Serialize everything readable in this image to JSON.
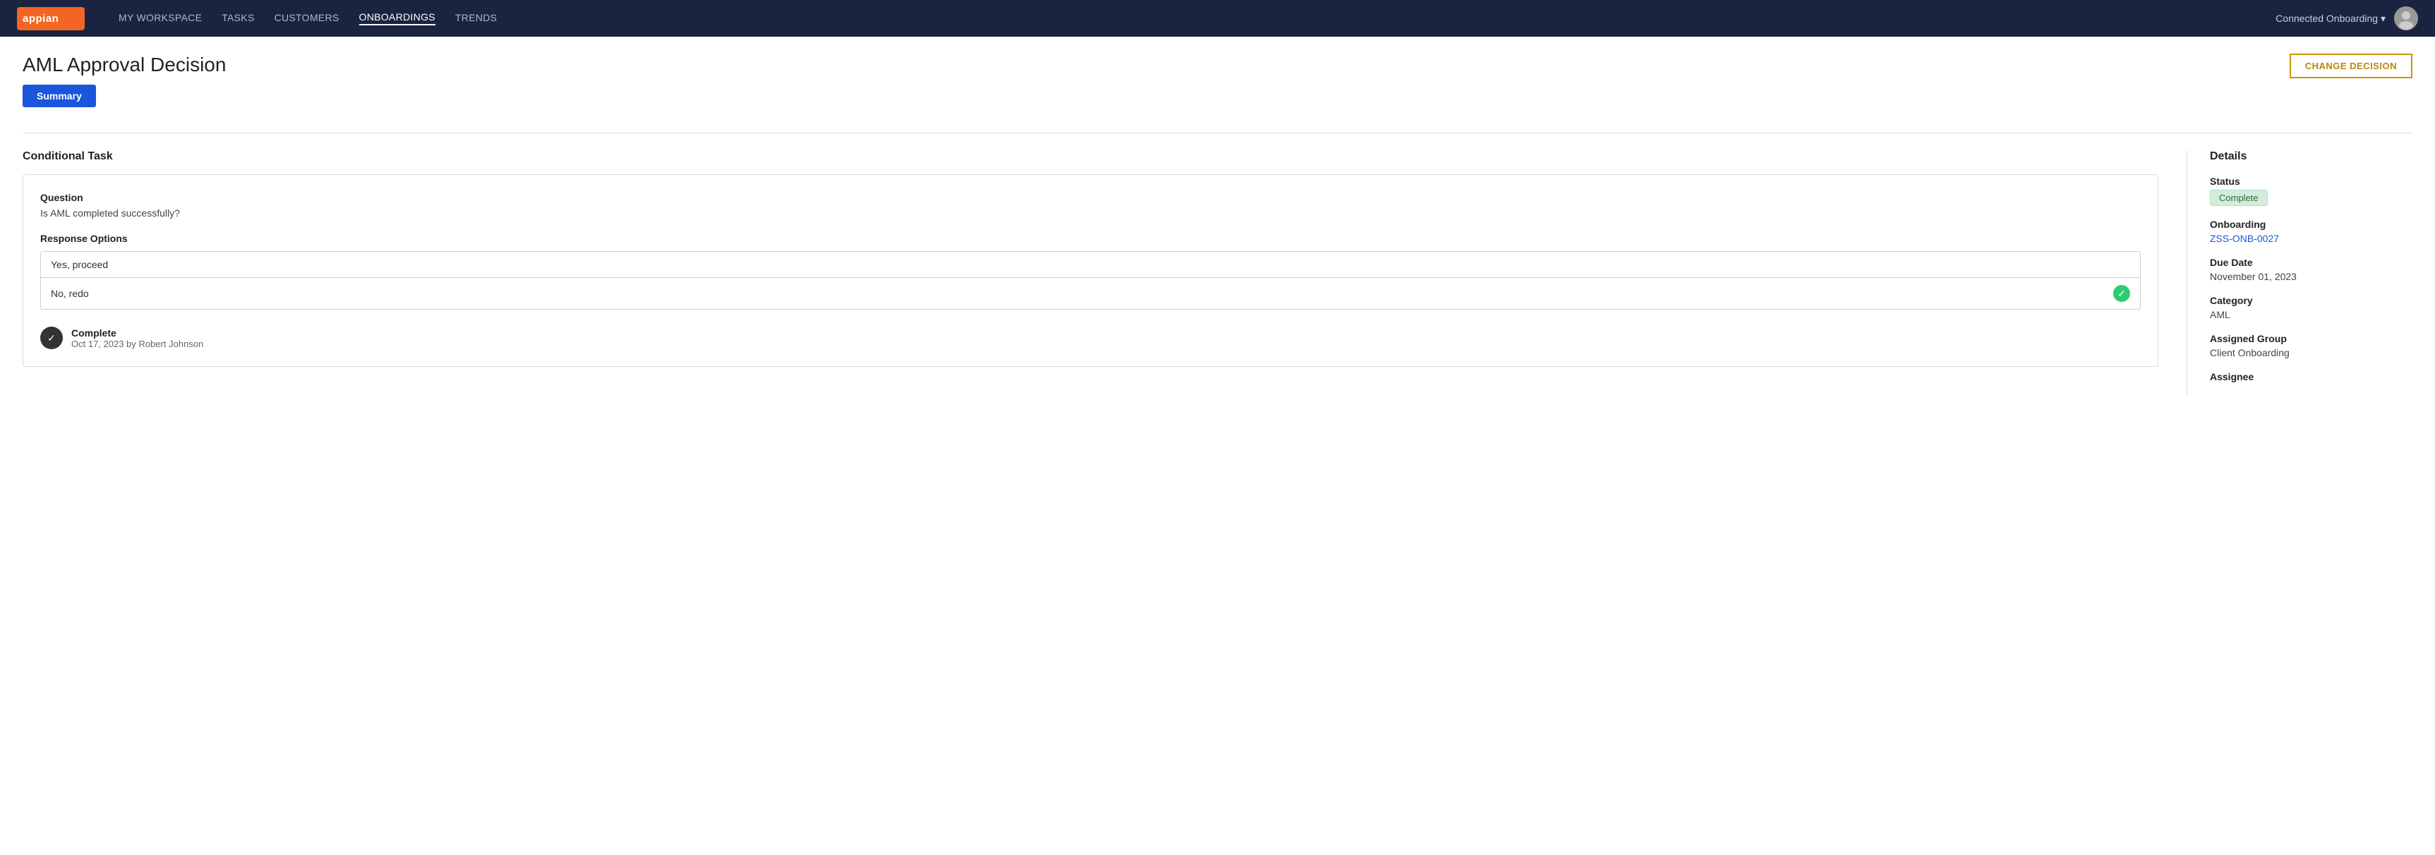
{
  "navbar": {
    "brand": "appian",
    "links": [
      {
        "label": "MY WORKSPACE",
        "active": false
      },
      {
        "label": "TASKS",
        "active": false
      },
      {
        "label": "CUSTOMERS",
        "active": false
      },
      {
        "label": "ONBOARDINGS",
        "active": true
      },
      {
        "label": "TRENDS",
        "active": false
      }
    ],
    "user_label": "Connected Onboarding ▾"
  },
  "page": {
    "title": "AML Approval Decision",
    "change_decision_btn": "CHANGE DECISION",
    "summary_tab": "Summary"
  },
  "conditional_task": {
    "section_title": "Conditional Task",
    "question_label": "Question",
    "question_value": "Is AML completed successfully?",
    "response_options_label": "Response Options",
    "options": [
      {
        "label": "Yes, proceed",
        "selected": false
      },
      {
        "label": "No, redo",
        "selected": true
      }
    ],
    "complete_label": "Complete",
    "complete_sub": "Oct 17, 2023 by Robert Johnson"
  },
  "details": {
    "section_title": "Details",
    "status_label": "Status",
    "status_value": "Complete",
    "onboarding_label": "Onboarding",
    "onboarding_value": "ZSS-ONB-0027",
    "due_date_label": "Due Date",
    "due_date_value": "November 01, 2023",
    "category_label": "Category",
    "category_value": "AML",
    "assigned_group_label": "Assigned Group",
    "assigned_group_value": "Client Onboarding",
    "assignee_label": "Assignee"
  }
}
